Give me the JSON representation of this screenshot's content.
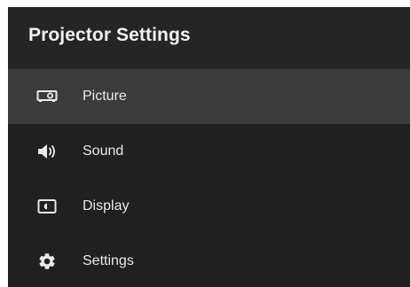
{
  "header": {
    "title": "Projector Settings"
  },
  "menu": {
    "items": [
      {
        "label": "Picture",
        "icon": "projector-icon",
        "active": true
      },
      {
        "label": "Sound",
        "icon": "speaker-icon",
        "active": false
      },
      {
        "label": "Display",
        "icon": "display-icon",
        "active": false
      },
      {
        "label": "Settings",
        "icon": "gear-icon",
        "active": false
      }
    ]
  },
  "colors": {
    "panel_background": "#202020",
    "header_background": "#252525",
    "active_row_background": "#3b3b3b",
    "text": "#e9e9e9"
  }
}
